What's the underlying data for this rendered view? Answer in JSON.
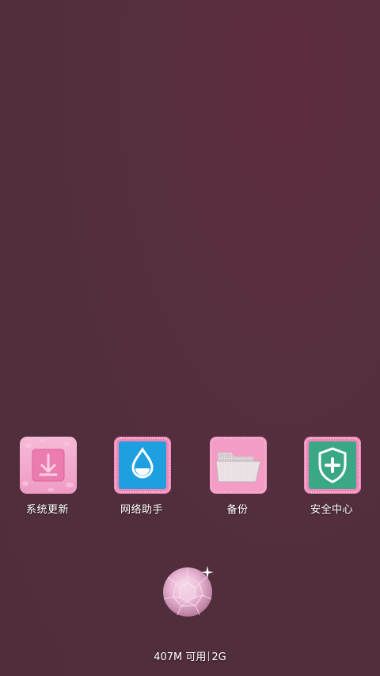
{
  "apps": [
    {
      "label": "系统更新",
      "icon": "download-icon"
    },
    {
      "label": "网络助手",
      "icon": "water-drop-icon"
    },
    {
      "label": "备份",
      "icon": "folder-icon"
    },
    {
      "label": "安全中心",
      "icon": "shield-plus-icon"
    }
  ],
  "center_button": {
    "icon": "diamond-icon"
  },
  "status": {
    "memory": "407M 可用",
    "network": "2G"
  },
  "colors": {
    "background": "#532e3d",
    "pink": "#f2a8cc",
    "blue": "#1ea0e0",
    "green": "#3aa886"
  }
}
